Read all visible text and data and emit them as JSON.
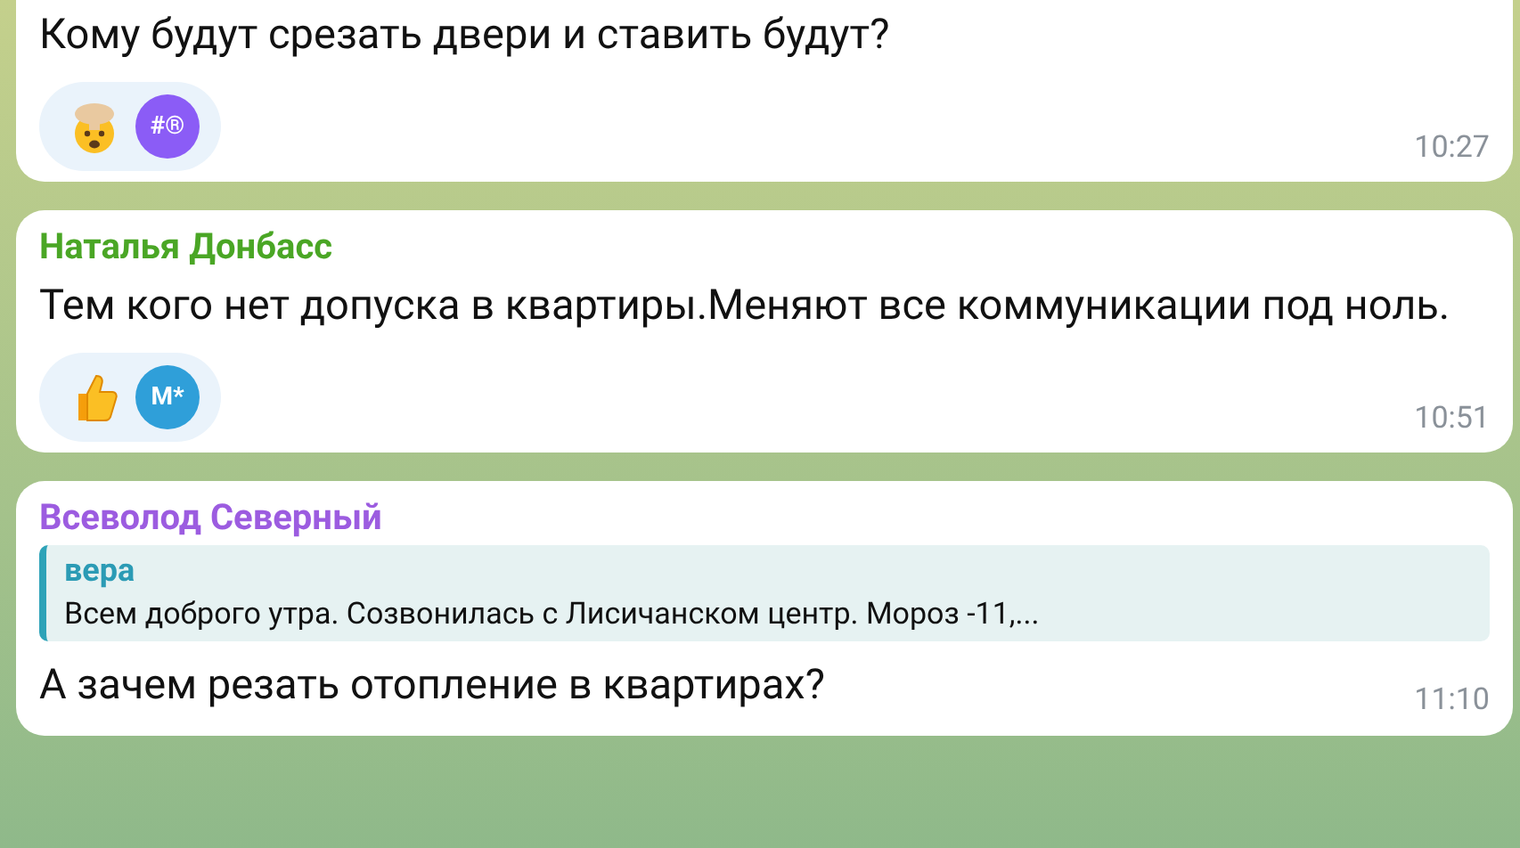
{
  "messages": [
    {
      "text": "Кому будут срезать двери и ставить будут?",
      "reactions": [
        {
          "kind": "exploding",
          "avatar": "#®",
          "color": "#8b5cf6"
        }
      ],
      "time": "10:27"
    },
    {
      "sender": "Наталья Донбасс",
      "color": "#4aa625",
      "text": "Тем кого нет допуска в квартиры.Меняют все коммуникации под ноль.",
      "reactions": [
        {
          "kind": "thumbs",
          "avatar": "M*",
          "color": "#2f9fd9"
        }
      ],
      "time": "10:51"
    },
    {
      "sender": "Всеволод Северный",
      "color": "#9c5ce0",
      "reply": {
        "author": "вера",
        "text": "Всем доброго утра. Созвонилась с Лисичанском центр. Мороз -11,..."
      },
      "text": "А зачем резать отопление в квартирах?",
      "time": "11:10"
    }
  ]
}
